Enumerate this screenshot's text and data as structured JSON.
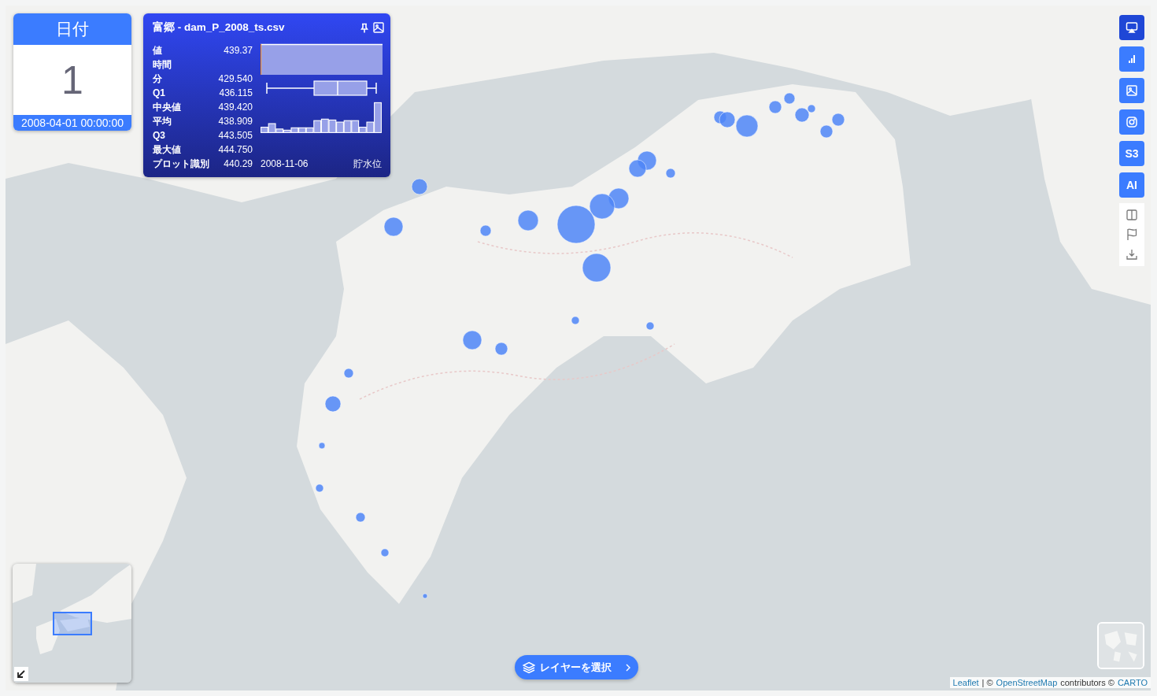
{
  "date_card": {
    "title": "日付",
    "value": "1",
    "timestamp": "2008-04-01 00:00:00"
  },
  "info_panel": {
    "title": "富郷 - dam_P_2008_ts.csv",
    "stats": [
      {
        "label": "値",
        "value": "439.37"
      },
      {
        "label": "時間"
      },
      {
        "label": "分",
        "value": "429.540"
      },
      {
        "label": "Q1",
        "value": "436.115"
      },
      {
        "label": "中央値",
        "value": "439.420"
      },
      {
        "label": "平均",
        "value": "438.909"
      },
      {
        "label": "Q3",
        "value": "443.505"
      },
      {
        "label": "最大値",
        "value": "444.750"
      }
    ],
    "footer": {
      "label": "プロット識別",
      "value": "440.29",
      "date": "2008-11-06",
      "series": "貯水位"
    }
  },
  "toolbar": [
    {
      "kind": "icon",
      "selected": true
    },
    {
      "kind": "icon",
      "selected": false
    },
    {
      "kind": "icon",
      "selected": false
    },
    {
      "kind": "icon",
      "selected": false
    },
    {
      "kind": "text",
      "label": "S3",
      "selected": false
    },
    {
      "kind": "text",
      "label": "AI",
      "selected": false
    }
  ],
  "layer_button": {
    "label": "レイヤーを選択"
  },
  "attribution": [
    {
      "kind": "link",
      "text": "Leaflet"
    },
    {
      "kind": "text",
      "text": "| ©"
    },
    {
      "kind": "link",
      "text": "OpenStreetMap"
    },
    {
      "kind": "text",
      "text": "contributors ©"
    },
    {
      "kind": "link",
      "text": "CARTO"
    }
  ]
}
